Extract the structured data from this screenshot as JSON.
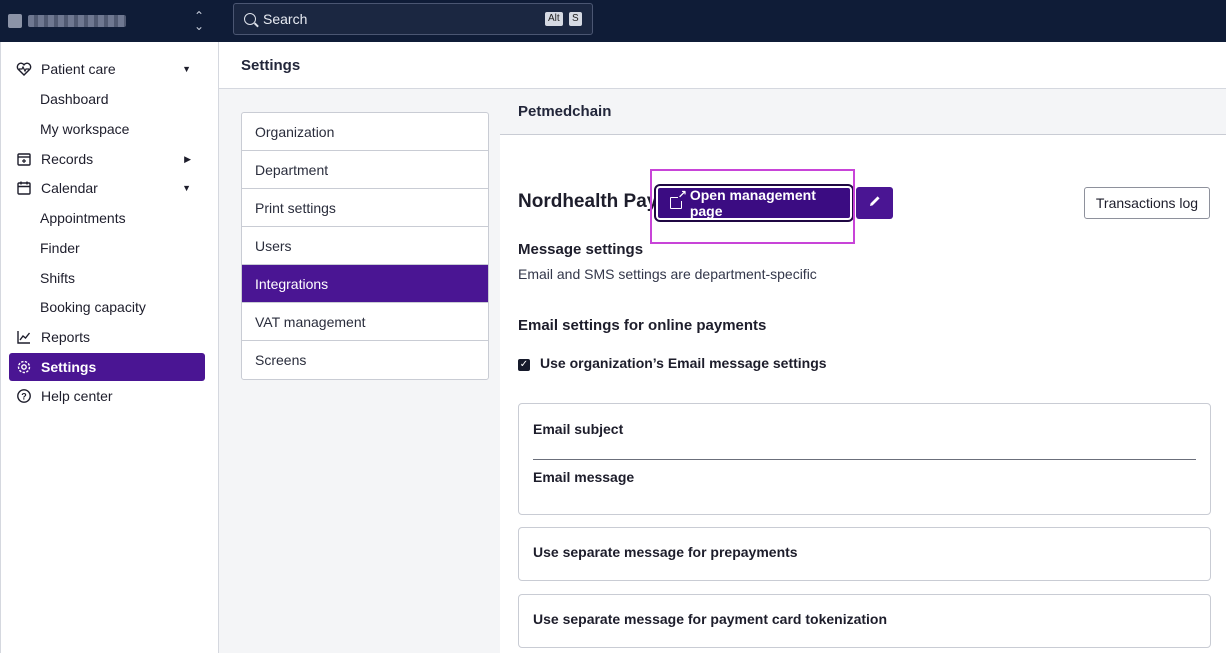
{
  "topbar": {
    "search_label": "Search",
    "kbd_alt": "Alt",
    "kbd_s": "S"
  },
  "sidebar": {
    "items": [
      {
        "label": "Patient care",
        "icon": "heart-pulse-icon",
        "caret": "▼"
      },
      {
        "label": "Dashboard"
      },
      {
        "label": "My workspace"
      },
      {
        "label": "Records",
        "icon": "records-icon",
        "caret": "▶"
      },
      {
        "label": "Calendar",
        "icon": "calendar-icon",
        "caret": "▼"
      },
      {
        "label": "Appointments"
      },
      {
        "label": "Finder"
      },
      {
        "label": "Shifts"
      },
      {
        "label": "Booking capacity"
      },
      {
        "label": "Reports",
        "icon": "chart-line-icon"
      },
      {
        "label": "Settings",
        "icon": "gear-icon",
        "active": true
      },
      {
        "label": "Help center",
        "icon": "help-circle-icon"
      }
    ]
  },
  "header": {
    "title": "Settings"
  },
  "settings_nav": {
    "items": [
      {
        "label": "Organization"
      },
      {
        "label": "Department"
      },
      {
        "label": "Print settings"
      },
      {
        "label": "Users"
      },
      {
        "label": "Integrations",
        "active": true
      },
      {
        "label": "VAT management"
      },
      {
        "label": "Screens"
      }
    ]
  },
  "panel": {
    "title": "Petmedchain",
    "integration_title": "Nordhealth Pay",
    "open_button": "Open management page",
    "transactions_button": "Transactions log",
    "message_settings_heading": "Message settings",
    "message_settings_desc": "Email and SMS settings are department-specific",
    "email_settings_heading": "Email settings for online payments",
    "use_org_checkbox": {
      "label": "Use organization’s Email message settings",
      "checked": true
    },
    "email_subject_label": "Email subject",
    "email_message_label": "Email message",
    "prepayments_label": "Use separate message for prepayments",
    "tokenization_label": "Use separate message for payment card tokenization"
  },
  "colors": {
    "topbar": "#0f1c37",
    "accent": "#4a1593",
    "highlight": "#c844d8"
  }
}
